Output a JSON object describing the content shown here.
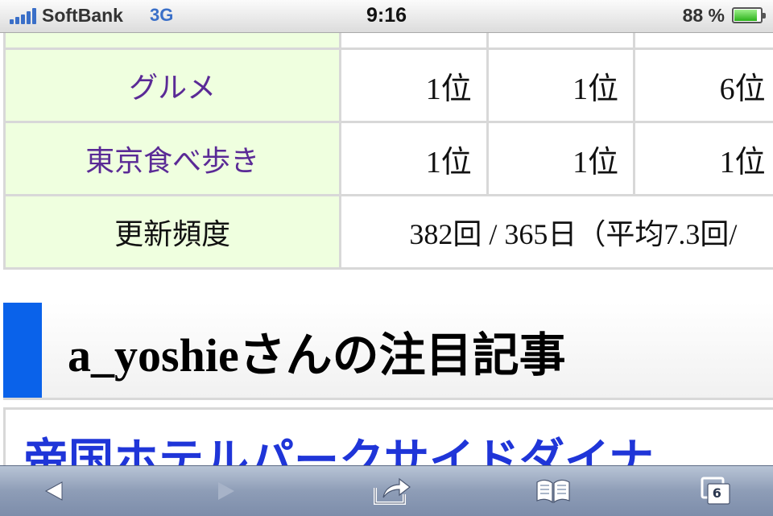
{
  "status_bar": {
    "carrier": "SoftBank",
    "network": "3G",
    "time": "9:16",
    "battery_text": "88 %",
    "battery_level": 0.88,
    "signal_icon": "signal-bars-icon",
    "battery_icon": "battery-icon"
  },
  "ranking_table": {
    "rows": [
      {
        "category": "グルメ",
        "ranks": [
          "1位",
          "1位",
          "6位"
        ]
      },
      {
        "category": "東京食べ歩き",
        "ranks": [
          "1位",
          "1位",
          "1位"
        ]
      }
    ],
    "frequency": {
      "label": "更新頻度",
      "value": "382回 / 365日（平均7.3回/"
    }
  },
  "section": {
    "title": "a_yoshieさんの注目記事",
    "accent_color": "#0a62ea"
  },
  "article": {
    "title": "帝国ホテルパークサイドダイナ",
    "link_color": "#1f35d8"
  },
  "toolbar": {
    "back_icon": "back-arrow-icon",
    "forward_icon": "forward-arrow-icon",
    "share_icon": "share-icon",
    "bookmarks_icon": "bookmarks-icon",
    "tabs_icon": "tabs-icon",
    "tabs_count": "6"
  }
}
